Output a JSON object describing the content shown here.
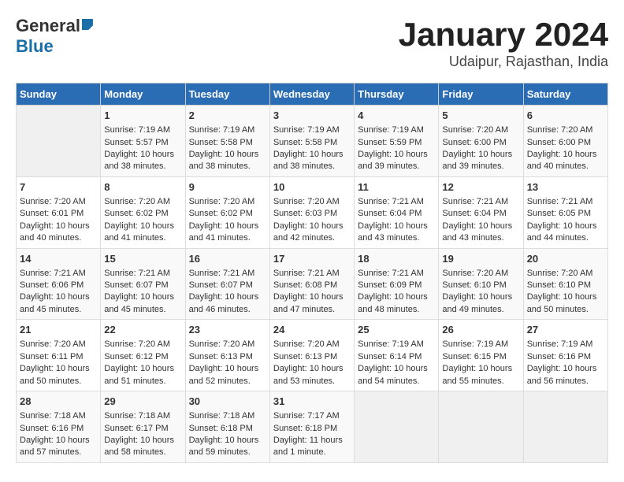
{
  "header": {
    "logo_general": "General",
    "logo_blue": "Blue",
    "month_title": "January 2024",
    "subtitle": "Udaipur, Rajasthan, India"
  },
  "columns": [
    "Sunday",
    "Monday",
    "Tuesday",
    "Wednesday",
    "Thursday",
    "Friday",
    "Saturday"
  ],
  "weeks": [
    [
      {
        "day": "",
        "info": ""
      },
      {
        "day": "1",
        "info": "Sunrise: 7:19 AM\nSunset: 5:57 PM\nDaylight: 10 hours\nand 38 minutes."
      },
      {
        "day": "2",
        "info": "Sunrise: 7:19 AM\nSunset: 5:58 PM\nDaylight: 10 hours\nand 38 minutes."
      },
      {
        "day": "3",
        "info": "Sunrise: 7:19 AM\nSunset: 5:58 PM\nDaylight: 10 hours\nand 38 minutes."
      },
      {
        "day": "4",
        "info": "Sunrise: 7:19 AM\nSunset: 5:59 PM\nDaylight: 10 hours\nand 39 minutes."
      },
      {
        "day": "5",
        "info": "Sunrise: 7:20 AM\nSunset: 6:00 PM\nDaylight: 10 hours\nand 39 minutes."
      },
      {
        "day": "6",
        "info": "Sunrise: 7:20 AM\nSunset: 6:00 PM\nDaylight: 10 hours\nand 40 minutes."
      }
    ],
    [
      {
        "day": "7",
        "info": "Sunrise: 7:20 AM\nSunset: 6:01 PM\nDaylight: 10 hours\nand 40 minutes."
      },
      {
        "day": "8",
        "info": "Sunrise: 7:20 AM\nSunset: 6:02 PM\nDaylight: 10 hours\nand 41 minutes."
      },
      {
        "day": "9",
        "info": "Sunrise: 7:20 AM\nSunset: 6:02 PM\nDaylight: 10 hours\nand 41 minutes."
      },
      {
        "day": "10",
        "info": "Sunrise: 7:20 AM\nSunset: 6:03 PM\nDaylight: 10 hours\nand 42 minutes."
      },
      {
        "day": "11",
        "info": "Sunrise: 7:21 AM\nSunset: 6:04 PM\nDaylight: 10 hours\nand 43 minutes."
      },
      {
        "day": "12",
        "info": "Sunrise: 7:21 AM\nSunset: 6:04 PM\nDaylight: 10 hours\nand 43 minutes."
      },
      {
        "day": "13",
        "info": "Sunrise: 7:21 AM\nSunset: 6:05 PM\nDaylight: 10 hours\nand 44 minutes."
      }
    ],
    [
      {
        "day": "14",
        "info": "Sunrise: 7:21 AM\nSunset: 6:06 PM\nDaylight: 10 hours\nand 45 minutes."
      },
      {
        "day": "15",
        "info": "Sunrise: 7:21 AM\nSunset: 6:07 PM\nDaylight: 10 hours\nand 45 minutes."
      },
      {
        "day": "16",
        "info": "Sunrise: 7:21 AM\nSunset: 6:07 PM\nDaylight: 10 hours\nand 46 minutes."
      },
      {
        "day": "17",
        "info": "Sunrise: 7:21 AM\nSunset: 6:08 PM\nDaylight: 10 hours\nand 47 minutes."
      },
      {
        "day": "18",
        "info": "Sunrise: 7:21 AM\nSunset: 6:09 PM\nDaylight: 10 hours\nand 48 minutes."
      },
      {
        "day": "19",
        "info": "Sunrise: 7:20 AM\nSunset: 6:10 PM\nDaylight: 10 hours\nand 49 minutes."
      },
      {
        "day": "20",
        "info": "Sunrise: 7:20 AM\nSunset: 6:10 PM\nDaylight: 10 hours\nand 50 minutes."
      }
    ],
    [
      {
        "day": "21",
        "info": "Sunrise: 7:20 AM\nSunset: 6:11 PM\nDaylight: 10 hours\nand 50 minutes."
      },
      {
        "day": "22",
        "info": "Sunrise: 7:20 AM\nSunset: 6:12 PM\nDaylight: 10 hours\nand 51 minutes."
      },
      {
        "day": "23",
        "info": "Sunrise: 7:20 AM\nSunset: 6:13 PM\nDaylight: 10 hours\nand 52 minutes."
      },
      {
        "day": "24",
        "info": "Sunrise: 7:20 AM\nSunset: 6:13 PM\nDaylight: 10 hours\nand 53 minutes."
      },
      {
        "day": "25",
        "info": "Sunrise: 7:19 AM\nSunset: 6:14 PM\nDaylight: 10 hours\nand 54 minutes."
      },
      {
        "day": "26",
        "info": "Sunrise: 7:19 AM\nSunset: 6:15 PM\nDaylight: 10 hours\nand 55 minutes."
      },
      {
        "day": "27",
        "info": "Sunrise: 7:19 AM\nSunset: 6:16 PM\nDaylight: 10 hours\nand 56 minutes."
      }
    ],
    [
      {
        "day": "28",
        "info": "Sunrise: 7:18 AM\nSunset: 6:16 PM\nDaylight: 10 hours\nand 57 minutes."
      },
      {
        "day": "29",
        "info": "Sunrise: 7:18 AM\nSunset: 6:17 PM\nDaylight: 10 hours\nand 58 minutes."
      },
      {
        "day": "30",
        "info": "Sunrise: 7:18 AM\nSunset: 6:18 PM\nDaylight: 10 hours\nand 59 minutes."
      },
      {
        "day": "31",
        "info": "Sunrise: 7:17 AM\nSunset: 6:18 PM\nDaylight: 11 hours\nand 1 minute."
      },
      {
        "day": "",
        "info": ""
      },
      {
        "day": "",
        "info": ""
      },
      {
        "day": "",
        "info": ""
      }
    ]
  ]
}
